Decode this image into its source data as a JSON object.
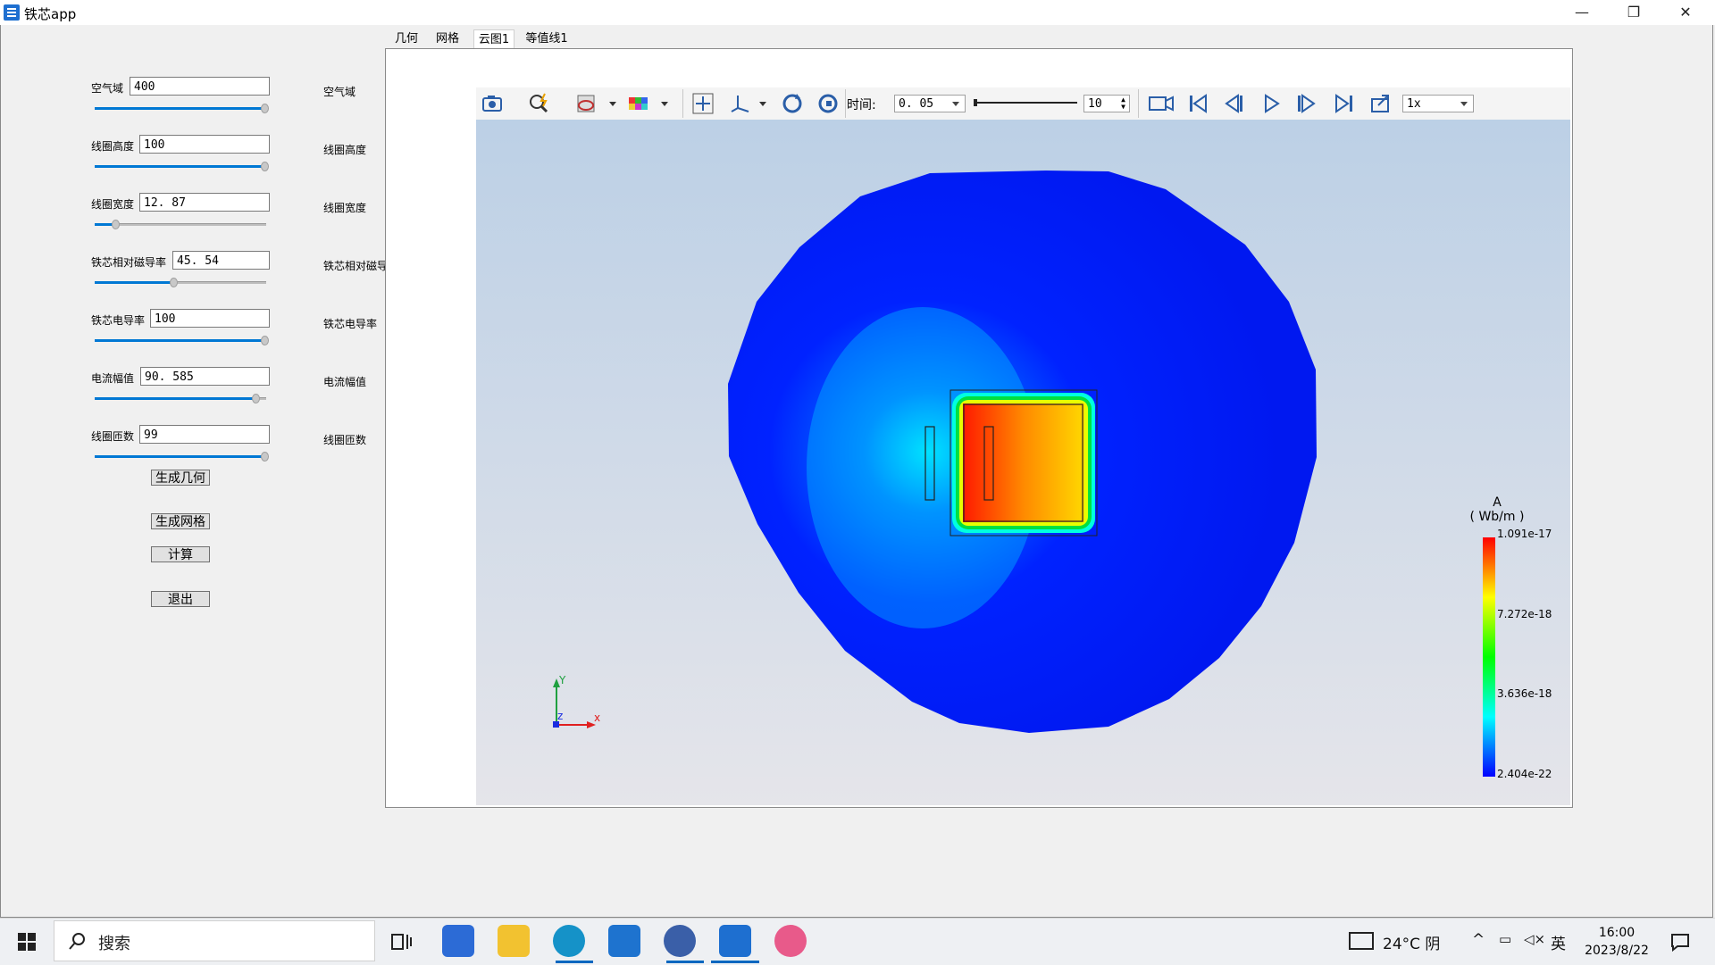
{
  "window": {
    "title": "铁芯app",
    "controls": [
      "—",
      "❐",
      "✕"
    ]
  },
  "params": [
    {
      "label": "空气域",
      "value": "400",
      "right_label": "空气域",
      "slider": 0.99
    },
    {
      "label": "线圈高度",
      "value": "100",
      "right_label": "线圈高度",
      "slider": 0.99
    },
    {
      "label": "线圈宽度",
      "value": "12. 87",
      "right_label": "线圈宽度",
      "slider": 0.12
    },
    {
      "label": "铁芯相对磁导率",
      "value": "45. 54",
      "right_label": "铁芯相对磁导",
      "slider": 0.46
    },
    {
      "label": "铁芯电导率",
      "value": "100",
      "right_label": "铁芯电导率",
      "slider": 0.99
    },
    {
      "label": "电流幅值",
      "value": "90. 585",
      "right_label": "电流幅值",
      "slider": 0.94
    },
    {
      "label": "线圈匝数",
      "value": "99",
      "right_label": "线圈匝数",
      "slider": 0.99
    }
  ],
  "buttons": {
    "gen_geometry": "生成几何",
    "gen_mesh": "生成网格",
    "compute": "计算",
    "exit": "退出"
  },
  "tabs": [
    {
      "label": "几何",
      "active": false
    },
    {
      "label": "网格",
      "active": false
    },
    {
      "label": "云图1",
      "active": true
    },
    {
      "label": "等值线1",
      "active": false
    }
  ],
  "toolbar": {
    "time_label": "时间:",
    "time_value": "0. 05",
    "frame_value": "10",
    "speed_value": "1x",
    "icons": [
      "camera-icon",
      "zoom-fit-icon",
      "view-options-icon",
      "color-grid-icon",
      "pan-icon",
      "axes-icon",
      "rotate-icon",
      "reset-rotate-icon",
      "record-icon",
      "first-frame-icon",
      "prev-frame-icon",
      "play-icon",
      "next-frame-icon",
      "last-frame-icon",
      "export-icon"
    ]
  },
  "colorbar": {
    "title": "A",
    "unit": "( Wb/m )",
    "ticks": [
      "1.091e-17",
      "7.272e-18",
      "3.636e-18",
      "2.404e-22"
    ],
    "colors": [
      "#ff0000",
      "#ffff00",
      "#00ff00",
      "#00ffff",
      "#0000ff"
    ]
  },
  "axes": {
    "x": "x",
    "y": "Y",
    "z": "z"
  },
  "status_dot": ":",
  "taskbar": {
    "search": "搜索",
    "weather": "24°C 阴",
    "ime": "英",
    "time": "16:00",
    "date": "2023/8/22"
  }
}
